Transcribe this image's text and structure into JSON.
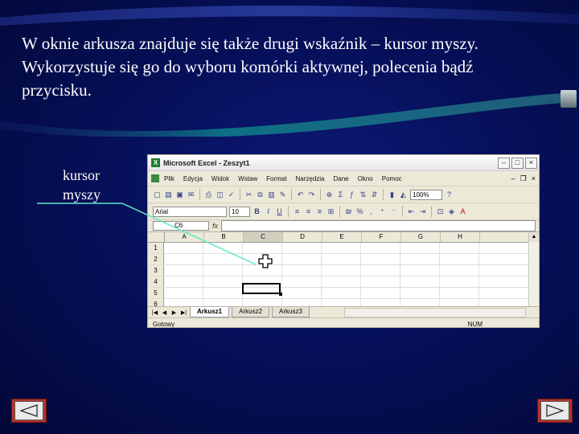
{
  "slide": {
    "title_lines": [
      "W oknie arkusza znajduje się także drugi wskaźnik – kursor myszy.",
      "Wykorzystuje się go do wyboru komórki aktywnej, polecenia bądź",
      "przycisku."
    ],
    "callout_lines": [
      "kursor",
      "myszy"
    ],
    "accent_color": "#5ee6c9"
  },
  "excel": {
    "window_title": "Microsoft Excel - Zeszyt1",
    "menu": [
      "Plik",
      "Edycja",
      "Widok",
      "Wstaw",
      "Format",
      "Narzędzia",
      "Dane",
      "Okno",
      "Pomoc"
    ],
    "zoom": "100%",
    "font": "Arial",
    "font_size": "10",
    "name_box": "C6",
    "fx_label": "fx",
    "columns": [
      "A",
      "B",
      "C",
      "D",
      "E",
      "F",
      "G",
      "H"
    ],
    "active_column": "C",
    "rows": [
      "1",
      "2",
      "3",
      "4",
      "5",
      "6"
    ],
    "sheet_tabs": [
      "Arkusz1",
      "Arkusz2",
      "Arkusz3"
    ],
    "active_tab": "Arkusz1",
    "status_left": "Gotowy",
    "status_right": "NUM"
  },
  "navigation": {
    "prev_icon": "triangle-left-icon",
    "next_icon": "triangle-right-icon",
    "button_color": "#b9332a"
  }
}
